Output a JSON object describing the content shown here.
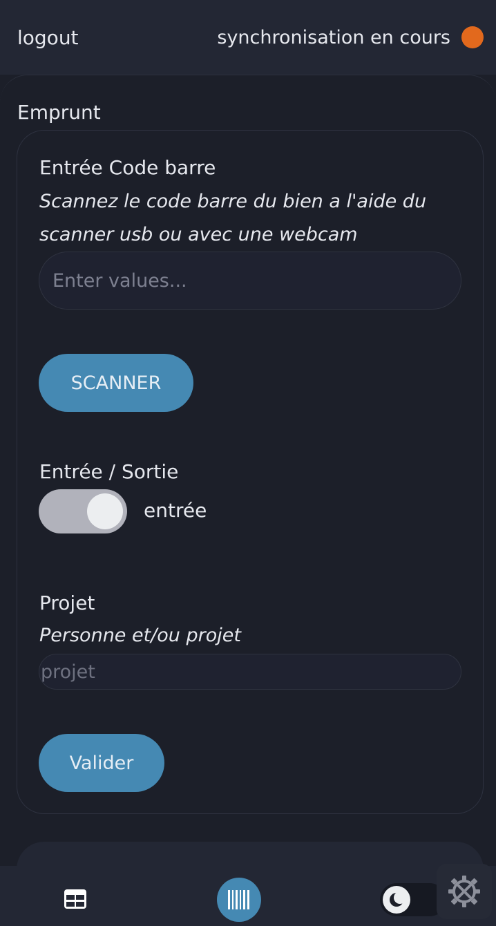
{
  "header": {
    "logout_label": "logout",
    "sync_status": "synchronisation en cours",
    "sync_color": "#e2691d"
  },
  "main": {
    "section_title": "Emprunt",
    "barcode": {
      "label": "Entrée Code barre",
      "hint": "Scannez le code barre du bien a l'aide du scanner usb ou avec une webcam",
      "placeholder": "Enter values...",
      "value": ""
    },
    "scan_button": "SCANNER",
    "direction": {
      "label": "Entrée / Sortie",
      "value_label": "entrée",
      "checked": true
    },
    "project": {
      "label": "Projet",
      "hint": "Personne et/ou projet",
      "placeholder": "projet",
      "value": ""
    },
    "submit_button": "Valider"
  },
  "bottom_nav": {
    "items": [
      {
        "icon": "table-icon"
      },
      {
        "icon": "barcode-icon",
        "active": true
      },
      {
        "icon": "moon-icon"
      },
      {
        "icon": "settings-tools-icon"
      }
    ]
  },
  "colors": {
    "accent": "#4589b3",
    "background": "#1c1f29",
    "bar": "#232734"
  }
}
